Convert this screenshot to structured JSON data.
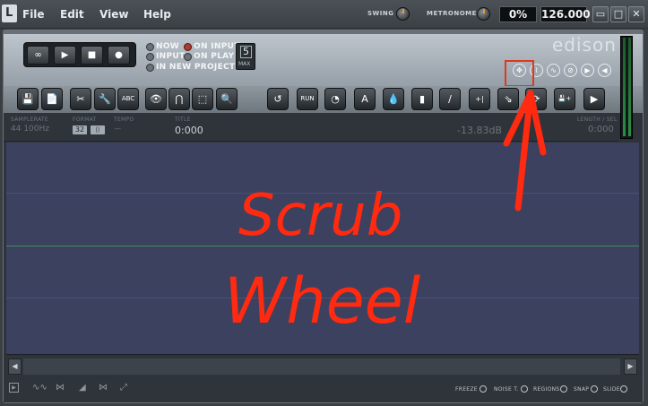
{
  "menubar": {
    "logo_letter": "L",
    "items": [
      "File",
      "Edit",
      "View",
      "Help"
    ],
    "swing_label": "SWING",
    "metronome_label": "METRONOME",
    "percent_value": "0%",
    "tempo_value": "126.000",
    "window_buttons": [
      "▭",
      "□",
      "✕"
    ]
  },
  "edison": {
    "brand": "edison",
    "transport": [
      "∞",
      "▶",
      "■",
      "●"
    ],
    "options": {
      "now": "NOW",
      "input": "INPUT",
      "on_input": "ON INPUT",
      "on_play": "ON PLAY",
      "in_new_project": "IN NEW PROJECT"
    },
    "max_value": "5",
    "max_label": "MAX",
    "small_icons": [
      "✥",
      "⌇",
      "∿",
      "⊘",
      "▶",
      "◀"
    ],
    "tools": [
      "💾",
      "📄",
      "✂",
      "🔧",
      "ABC",
      "👁",
      "⋂",
      "⬚",
      "🔍",
      "↺",
      "RUN",
      "◔",
      "A",
      "💧",
      "▮",
      "∕",
      "+|",
      "⇘",
      "⟳",
      "💾+",
      "▶"
    ],
    "info": {
      "samplerate_label": "SAMPLERATE",
      "samplerate_value": "44 100Hz",
      "format_label": "FORMAT",
      "format_bits": "32",
      "format_icon": "⌷",
      "tempo_label": "TEMPO",
      "tempo_value": "—",
      "title_label": "TITLE",
      "title_value": "0:000",
      "level_value": "-13.83dB",
      "length_label": "LENGTH / SEL",
      "length_value": "0:000"
    },
    "scroll": {
      "left": "◀",
      "right": "▶"
    },
    "bottom": {
      "play_icon": "▶",
      "labels": [
        "FREEZE",
        "NOISE T.",
        "REGIONS",
        "SNAP",
        "SLIDE"
      ]
    }
  },
  "annotation": {
    "text_line1": "Scrub",
    "text_line2": "Wheel",
    "color": "#ff2a10"
  }
}
